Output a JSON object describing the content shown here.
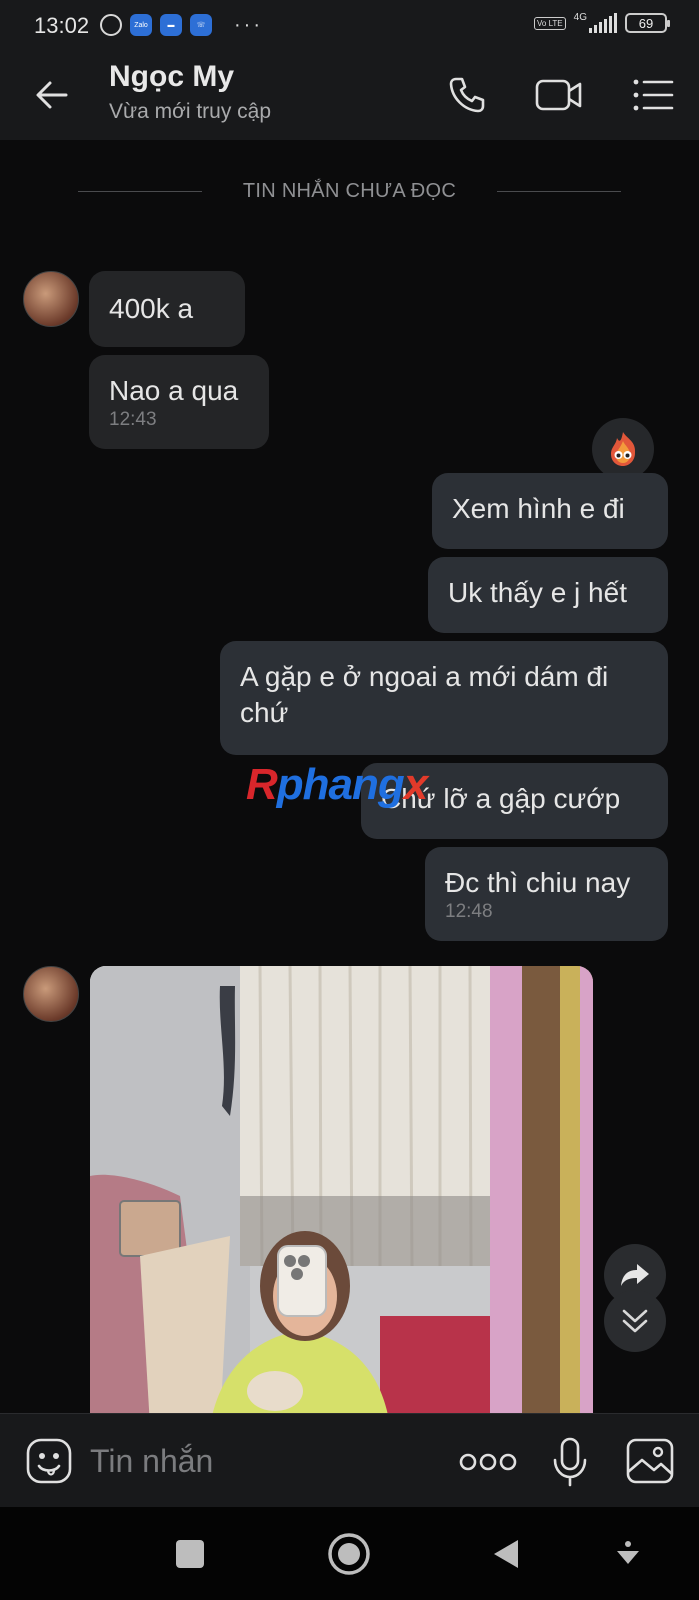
{
  "status_bar": {
    "time": "13:02",
    "network": "4G",
    "volte": "Vo LTE",
    "battery": "69",
    "overflow": "···",
    "app_icons": [
      "alarm-icon",
      "zalo-icon",
      "messenger-icon",
      "phone-icon"
    ]
  },
  "header": {
    "contact_name": "Ngọc My",
    "contact_status": "Vừa mới truy cập",
    "icons": [
      "back-arrow-icon",
      "phone-call-icon",
      "video-call-icon",
      "menu-list-icon"
    ]
  },
  "chat": {
    "unread_divider": "TIN NHẮN CHƯA ĐỌC",
    "messages": [
      {
        "side": "incoming",
        "text": "400k a"
      },
      {
        "side": "incoming",
        "text": "Nao a qua",
        "time": "12:43"
      },
      {
        "side": "outgoing",
        "text": "Xem hình e đi"
      },
      {
        "side": "outgoing",
        "text": "Uk thấy e j hết"
      },
      {
        "side": "outgoing",
        "text": "A gặp e ở ngoai a mới dám đi chứ"
      },
      {
        "side": "outgoing",
        "text": "Chứ lỡ a gập cướp"
      },
      {
        "side": "outgoing",
        "text": "Đc thì chiu nay",
        "time": "12:48"
      },
      {
        "side": "incoming",
        "type": "photo"
      }
    ],
    "reaction": "fire-face-reaction-icon",
    "watermark": {
      "r": "R",
      "middle": "phang",
      "x": "x"
    }
  },
  "input_bar": {
    "placeholder": "Tin nhắn",
    "icons": [
      "sticker-emoji-icon",
      "more-options-icon",
      "microphone-icon",
      "image-gallery-icon"
    ]
  },
  "colors": {
    "background": "#0b0b0c",
    "header_bg": "#18191b",
    "incoming_bubble": "#242527",
    "outgoing_bubble": "#2c3036",
    "watermark_blue": "#1f6fe0",
    "watermark_red": "#d8262b"
  }
}
